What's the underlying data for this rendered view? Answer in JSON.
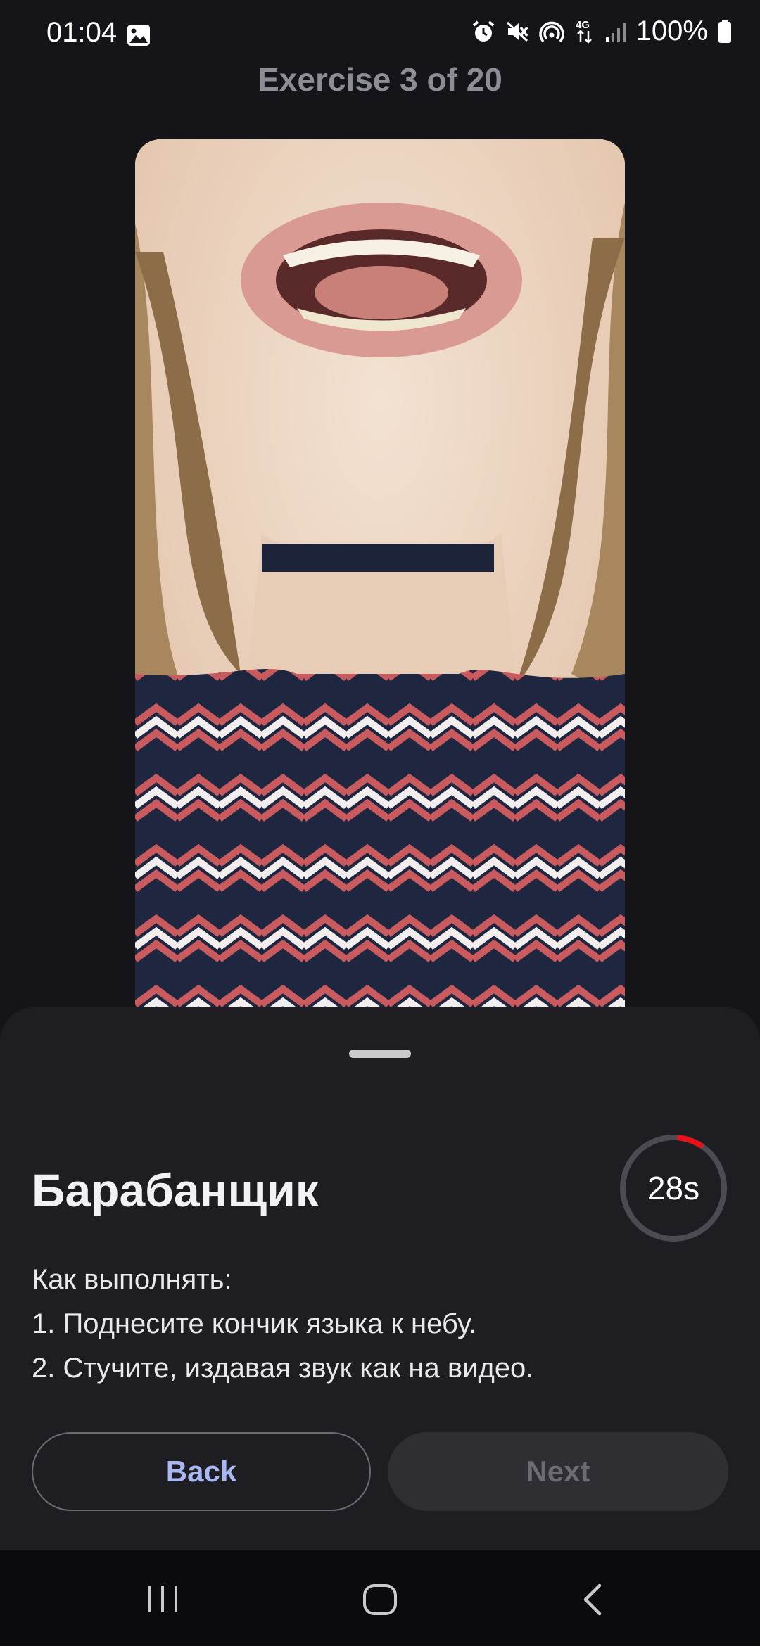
{
  "status_bar": {
    "time": "01:04",
    "battery": "100%",
    "icons": [
      "gallery-icon",
      "alarm-icon",
      "mute-icon",
      "hotspot-icon",
      "4g-icon",
      "signal-icon",
      "battery-icon"
    ]
  },
  "header": {
    "title": "Exercise 3 of 20"
  },
  "video": {
    "icon": "video-player"
  },
  "sheet": {
    "exercise_name": "Барабанщик",
    "timer": {
      "label": "28s",
      "remaining_fraction": 0.93
    },
    "instructions": [
      "Как выполнять:",
      "1. Поднесите кончик языка к небу.",
      "2. Стучите, издавая звук как на видео."
    ],
    "back_label": "Back",
    "next_label": "Next"
  },
  "colors": {
    "background": "#141419",
    "sheet": "#1d1d22",
    "accent_link": "#a9b8f2",
    "timer_arc": "#e8121a"
  },
  "nav_bar": {
    "icons": [
      "recents-icon",
      "home-icon",
      "back-icon"
    ]
  }
}
